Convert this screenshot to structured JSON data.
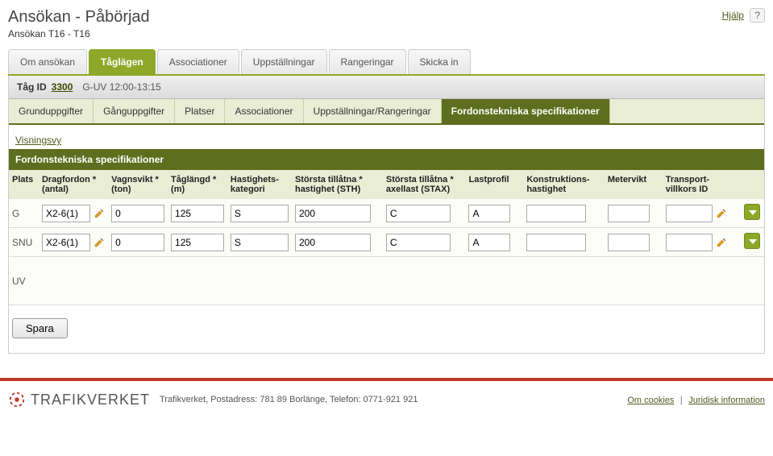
{
  "header": {
    "title": "Ansökan - Påbörjad",
    "subtitle": "Ansökan T16 - T16",
    "help_label": "Hjälp",
    "help_icon": "?"
  },
  "main_tabs": [
    {
      "label": "Om ansökan",
      "active": false
    },
    {
      "label": "Tåglägen",
      "active": true
    },
    {
      "label": "Associationer",
      "active": false
    },
    {
      "label": "Uppställningar",
      "active": false
    },
    {
      "label": "Rangeringar",
      "active": false
    },
    {
      "label": "Skicka in",
      "active": false
    }
  ],
  "tagid_bar": {
    "label": "Tåg ID",
    "value": "3300",
    "time": "G-UV 12:00-13:15"
  },
  "sub_tabs": [
    {
      "label": "Grunduppgifter",
      "active": false
    },
    {
      "label": "Gånguppgifter",
      "active": false
    },
    {
      "label": "Platser",
      "active": false
    },
    {
      "label": "Associationer",
      "active": false
    },
    {
      "label": "Uppställningar/Rangeringar",
      "active": false
    },
    {
      "label": "Fordonstekniska specifikationer",
      "active": true
    }
  ],
  "view_link": "Visningsvy",
  "section_title": "Fordonstekniska specifikationer",
  "columns": {
    "plats": "Plats",
    "dragfordon": "Dragfordon * (antal)",
    "vagnsvikt": "Vagnsvikt * (ton)",
    "taglangd": "Tåglängd * (m)",
    "hastighets": "Hastighets-kategori",
    "sth": "Största tillåtna * hastighet (STH)",
    "stax": "Största tillåtna * axellast (STAX)",
    "lastprofil": "Lastprofil",
    "konstr": "Konstruktions-hastighet",
    "metervikt": "Metervikt",
    "transport": "Transport-villkors ID"
  },
  "rows": [
    {
      "plats": "G",
      "dragfordon": "X2-6(1)",
      "vagnsvikt": "0",
      "taglangd": "125",
      "hastighets": "S",
      "sth": "200",
      "stax": "C",
      "lastprofil": "A",
      "konstr": "",
      "metervikt": "",
      "transport": ""
    },
    {
      "plats": "SNU",
      "dragfordon": "X2-6(1)",
      "vagnsvikt": "0",
      "taglangd": "125",
      "hastighets": "S",
      "sth": "200",
      "stax": "C",
      "lastprofil": "A",
      "konstr": "",
      "metervikt": "",
      "transport": ""
    },
    {
      "plats": "UV",
      "empty": true
    }
  ],
  "save_label": "Spara",
  "footer": {
    "brand": "TRAFIKVERKET",
    "address": "Trafikverket, Postadress: 781 89 Borlänge, Telefon: 0771-921 921",
    "links": {
      "cookies": "Om cookies",
      "legal": "Juridisk information"
    }
  }
}
